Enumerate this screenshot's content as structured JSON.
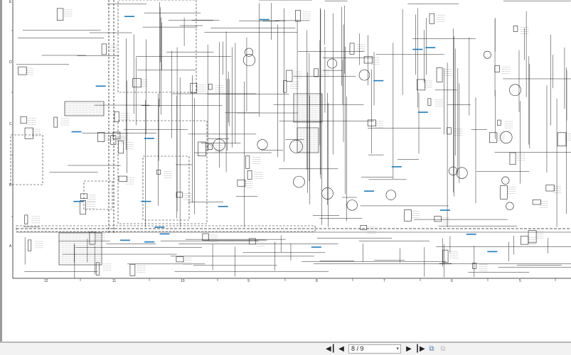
{
  "document": {
    "column_labels": [
      "12",
      "11",
      "10",
      "9",
      "8",
      "7",
      "6",
      "5"
    ],
    "row_labels": [
      "E",
      "D",
      "C",
      "B",
      "A"
    ]
  },
  "toolbar": {
    "page_indicator": "8 / 9",
    "first_icon": "first-page-icon",
    "prev_icon": "previous-page-icon",
    "next_icon": "next-page-icon",
    "last_icon": "last-page-icon",
    "fit_icon": "fit-page-icon",
    "rotate_icon": "page-view-icon"
  },
  "colors": {
    "wire": "#222222",
    "link": "#1a7bbf",
    "toolbar": "#f2f2f2"
  }
}
